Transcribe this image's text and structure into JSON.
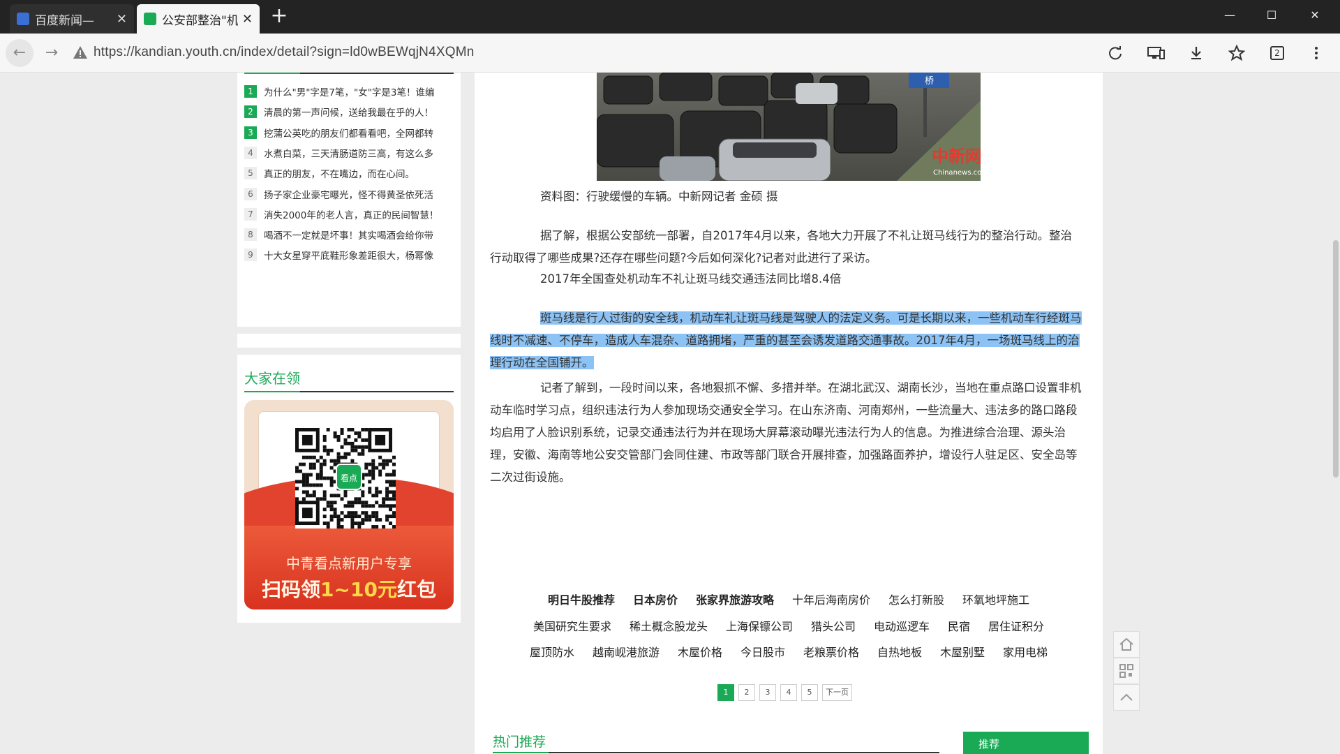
{
  "tabs": [
    {
      "title": "百度新闻—",
      "active": false
    },
    {
      "title": "公安部整治\"机",
      "active": true
    }
  ],
  "url": "https://kandian.youth.cn/index/detail?sign=ld0wBEWqjN4XQMn",
  "toolbar": {
    "tab_count": "2"
  },
  "hot_list": [
    {
      "num": "1",
      "text": "为什么\"男\"字是7笔，\"女\"字是3笔！谁编"
    },
    {
      "num": "2",
      "text": "清晨的第一声问候，送给我最在乎的人！"
    },
    {
      "num": "3",
      "text": "挖蒲公英吃的朋友们都看看吧，全网都转"
    },
    {
      "num": "4",
      "text": "水煮白菜，三天清肠道防三高，有这么多"
    },
    {
      "num": "5",
      "text": "真正的朋友，不在嘴边，而在心间。"
    },
    {
      "num": "6",
      "text": "扬子家企业豪宅曝光，怪不得黄圣依死活"
    },
    {
      "num": "7",
      "text": "消失2000年的老人言，真正的民间智慧！"
    },
    {
      "num": "8",
      "text": "喝酒不一定就是坏事！其实喝酒会给你带"
    },
    {
      "num": "9",
      "text": "十大女星穿平底鞋形象差距很大，杨幂像"
    }
  ],
  "lead": {
    "title": "大家在领",
    "qr_badge": "看点",
    "promo_line1": "中青看点新用户专享",
    "promo_prefix": "扫码领",
    "promo_amount": "1~10元",
    "promo_suffix": "红包"
  },
  "image": {
    "watermark": "中新网",
    "watermark_sub": "Chinanews.com",
    "sign_text": "桥"
  },
  "article": {
    "caption": "资料图：行驶缓慢的车辆。中新网记者 金硕 摄",
    "p1": "据了解，根据公安部统一部署，自2017年4月以来，各地大力开展了不礼让斑马线行为的整治行动。整治行动取得了哪些成果?还存在哪些问题?今后如何深化?记者对此进行了采访。",
    "subtitle": "2017年全国查处机动车不礼让斑马线交通违法同比增8.4倍",
    "p2": "斑马线是行人过街的安全线，机动车礼让斑马线是驾驶人的法定义务。可是长期以来，一些机动车行经斑马线时不减速、不停车，造成人车混杂、道路拥堵，严重的甚至会诱发道路交通事故。2017年4月，一场斑马线上的治理行动在全国铺开。",
    "p3": "记者了解到，一段时间以来，各地狠抓不懈、多措并举。在湖北武汉、湖南长沙，当地在重点路口设置非机动车临时学习点，组织违法行为人参加现场交通安全学习。在山东济南、河南郑州，一些流量大、违法多的路口路段均启用了人脸识别系统，记录交通违法行为并在现场大屏幕滚动曝光违法行为人的信息。为推进综合治理、源头治理，安徽、海南等地公安交管部门会同住建、市政等部门联合开展排查，加强路面养护，增设行人驻足区、安全岛等二次过街设施。"
  },
  "keywords": {
    "row1": [
      {
        "t": "明日牛股推荐",
        "bold": true
      },
      {
        "t": "日本房价",
        "bold": true
      },
      {
        "t": "张家界旅游攻略",
        "bold": true
      },
      {
        "t": "十年后海南房价",
        "bold": false
      },
      {
        "t": "怎么打新股",
        "bold": false
      },
      {
        "t": "环氧地坪施工",
        "bold": false
      }
    ],
    "row2": [
      "美国研究生要求",
      "稀土概念股龙头",
      "上海保镖公司",
      "猎头公司",
      "电动巡逻车",
      "民宿",
      "居住证积分"
    ],
    "row3": [
      "屋顶防水",
      "越南岘港旅游",
      "木屋价格",
      "今日股市",
      "老粮票价格",
      "自热地板",
      "木屋别墅",
      "家用电梯"
    ]
  },
  "pager": {
    "pages": [
      "1",
      "2",
      "3",
      "4",
      "5"
    ],
    "next": "下一页",
    "current": "1"
  },
  "hot_recommend": {
    "title": "热门推荐",
    "tab": "推荐"
  },
  "colors": {
    "accent": "#1aaa55",
    "selection": "#8cc2f4",
    "tabbar": "#232323"
  }
}
